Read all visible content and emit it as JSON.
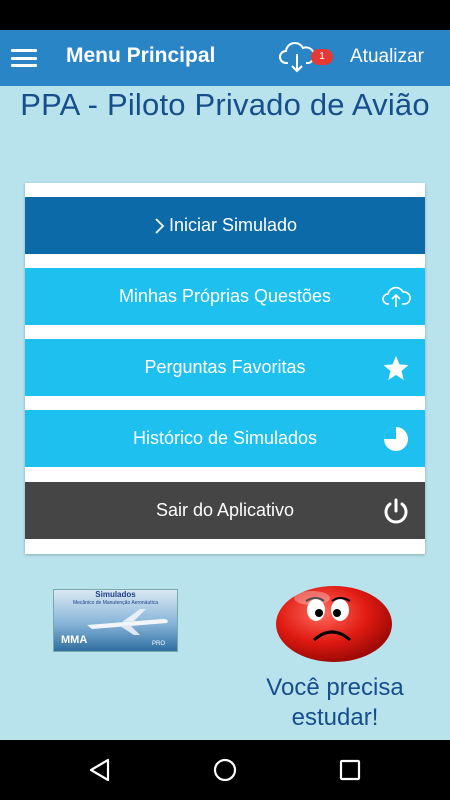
{
  "app_bar": {
    "title": "Menu Principal",
    "update_badge": "1",
    "update_label": "Atualizar"
  },
  "headline": "PPA - Piloto Privado de Avião",
  "menu": {
    "start_label": "Iniciar Simulado",
    "own_questions_label": "Minhas Próprias Questões",
    "favorites_label": "Perguntas Favoritas",
    "history_label": "Histórico de Simulados",
    "exit_label": "Sair do Aplicativo"
  },
  "promo": {
    "title": "Simulados",
    "subtitle": "Mecânico de Manutenção Aeronáutica",
    "brand": "MMA",
    "tag": "PRO"
  },
  "study_message": "Você precisa estudar!",
  "colors": {
    "app_bar": "#2a85c7",
    "start_button": "#0c6aa8",
    "menu_button": "#1ec0ef",
    "exit_button": "#454545",
    "background": "#b9e3ec",
    "headline": "#174e8c",
    "badge": "#e53935"
  }
}
